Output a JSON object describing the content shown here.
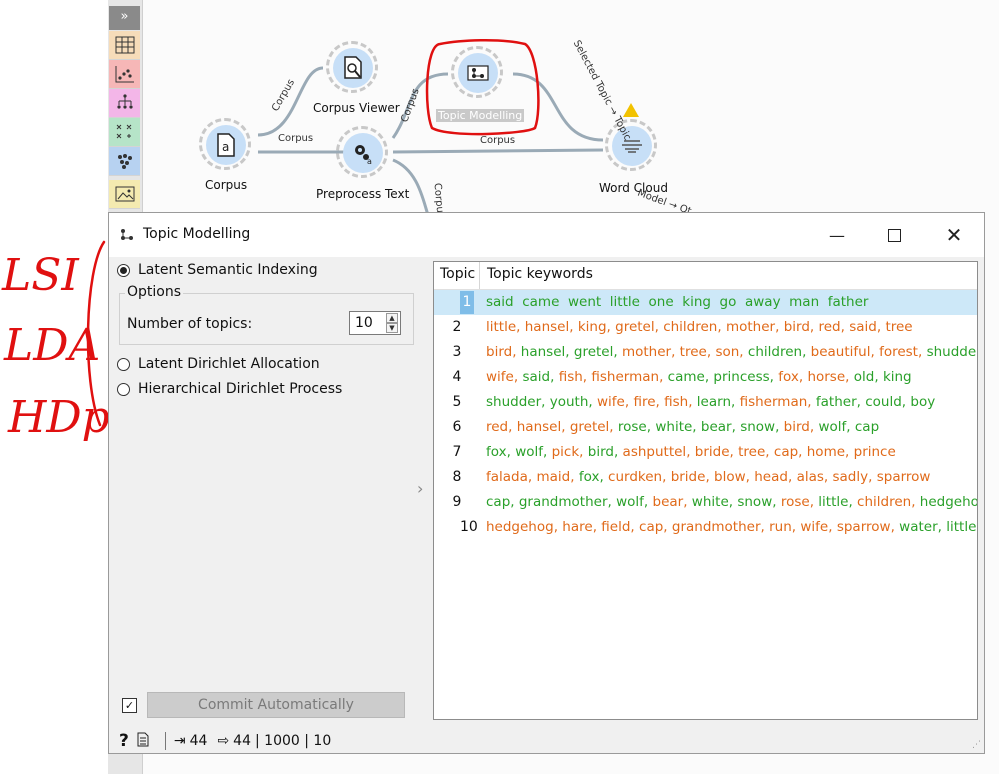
{
  "canvas": {
    "nodes": [
      {
        "label": "Corpus Viewer",
        "icon": "corpus-viewer-icon"
      },
      {
        "label": "Topic Modelling",
        "icon": "topic-modelling-icon"
      },
      {
        "label": "Corpus",
        "icon": "corpus-icon"
      },
      {
        "label": "Preprocess Text",
        "icon": "preprocess-text-icon"
      },
      {
        "label": "Word Cloud",
        "icon": "word-cloud-icon"
      }
    ],
    "links": [
      {
        "label": "Corpus"
      },
      {
        "label": "Corpus"
      },
      {
        "label": "Corpus"
      },
      {
        "label": "Corpus"
      },
      {
        "label": "Selected Topic → Topic"
      },
      {
        "label": "Corpus"
      },
      {
        "label": "Model → Ot"
      }
    ],
    "toolbox": {
      "collapse_label": "»"
    }
  },
  "annotations": {
    "left_labels": [
      "LSI",
      "LDA",
      "HDp"
    ]
  },
  "dialog": {
    "title": "Topic Modelling",
    "title_icon": "topic-modelling-icon",
    "methods": [
      {
        "label": "Latent Semantic Indexing",
        "selected": true
      },
      {
        "label": "Latent Dirichlet Allocation",
        "selected": false
      },
      {
        "label": "Hierarchical Dirichlet Process",
        "selected": false
      }
    ],
    "options_legend": "Options",
    "num_topics_label": "Number of topics:",
    "num_topics_value": "10",
    "table": {
      "headers": [
        "Topic",
        "Topic keywords"
      ],
      "rows": [
        {
          "topic": "1",
          "keywords": [
            "said",
            "came",
            "went",
            "little",
            "one",
            "king",
            "go",
            "away",
            "man",
            "father"
          ],
          "colors": [
            "#2aa02a",
            "#2aa02a",
            "#2aa02a",
            "#2aa02a",
            "#2aa02a",
            "#2aa02a",
            "#2aa02a",
            "#2aa02a",
            "#2aa02a",
            "#2aa02a"
          ],
          "sep": "  "
        },
        {
          "topic": "2",
          "keywords": [
            "little",
            "hansel",
            "king",
            "gretel",
            "children",
            "mother",
            "bird",
            "red",
            "said",
            "tree"
          ],
          "colors": [
            "#e06a1a",
            "#e06a1a",
            "#e06a1a",
            "#e06a1a",
            "#e06a1a",
            "#e06a1a",
            "#e06a1a",
            "#e06a1a",
            "#e06a1a",
            "#e06a1a"
          ],
          "sep": ", "
        },
        {
          "topic": "3",
          "keywords": [
            "bird",
            "hansel",
            "gretel",
            "mother",
            "tree",
            "son",
            "children",
            "beautiful",
            "forest",
            "shudder"
          ],
          "colors": [
            "#e06a1a",
            "#2aa02a",
            "#2aa02a",
            "#e06a1a",
            "#e06a1a",
            "#e06a1a",
            "#2aa02a",
            "#e06a1a",
            "#e06a1a",
            "#2aa02a"
          ],
          "sep": ", "
        },
        {
          "topic": "4",
          "keywords": [
            "wife",
            "said",
            "fish",
            "fisherman",
            "came",
            "princess",
            "fox",
            "horse",
            "old",
            "king"
          ],
          "colors": [
            "#e06a1a",
            "#2aa02a",
            "#e06a1a",
            "#e06a1a",
            "#2aa02a",
            "#2aa02a",
            "#e06a1a",
            "#e06a1a",
            "#2aa02a",
            "#2aa02a"
          ],
          "sep": ", "
        },
        {
          "topic": "5",
          "keywords": [
            "shudder",
            "youth",
            "wife",
            "fire",
            "fish",
            "learn",
            "fisherman",
            "father",
            "could",
            "boy"
          ],
          "colors": [
            "#2aa02a",
            "#2aa02a",
            "#e06a1a",
            "#e06a1a",
            "#e06a1a",
            "#2aa02a",
            "#e06a1a",
            "#2aa02a",
            "#2aa02a",
            "#2aa02a"
          ],
          "sep": ", "
        },
        {
          "topic": "6",
          "keywords": [
            "red",
            "hansel",
            "gretel",
            "rose",
            "white",
            "bear",
            "snow",
            "bird",
            "wolf",
            "cap"
          ],
          "colors": [
            "#e06a1a",
            "#e06a1a",
            "#e06a1a",
            "#2aa02a",
            "#2aa02a",
            "#2aa02a",
            "#2aa02a",
            "#e06a1a",
            "#2aa02a",
            "#2aa02a"
          ],
          "sep": ", "
        },
        {
          "topic": "7",
          "keywords": [
            "fox",
            "wolf",
            "pick",
            "bird",
            "ashputtel",
            "bride",
            "tree",
            "cap",
            "home",
            "prince"
          ],
          "colors": [
            "#2aa02a",
            "#2aa02a",
            "#e06a1a",
            "#2aa02a",
            "#e06a1a",
            "#e06a1a",
            "#e06a1a",
            "#e06a1a",
            "#e06a1a",
            "#e06a1a"
          ],
          "sep": ", "
        },
        {
          "topic": "8",
          "keywords": [
            "falada",
            "maid",
            "fox",
            "curdken",
            "bride",
            "blow",
            "head",
            "alas",
            "sadly",
            "sparrow"
          ],
          "colors": [
            "#e06a1a",
            "#e06a1a",
            "#2aa02a",
            "#e06a1a",
            "#e06a1a",
            "#e06a1a",
            "#e06a1a",
            "#e06a1a",
            "#e06a1a",
            "#e06a1a"
          ],
          "sep": ", "
        },
        {
          "topic": "9",
          "keywords": [
            "cap",
            "grandmother",
            "wolf",
            "bear",
            "white",
            "snow",
            "rose",
            "little",
            "children",
            "hedgehog"
          ],
          "colors": [
            "#2aa02a",
            "#2aa02a",
            "#2aa02a",
            "#e06a1a",
            "#2aa02a",
            "#2aa02a",
            "#e06a1a",
            "#2aa02a",
            "#e06a1a",
            "#2aa02a"
          ],
          "sep": ", "
        },
        {
          "topic": "10",
          "keywords": [
            "hedgehog",
            "hare",
            "field",
            "cap",
            "grandmother",
            "run",
            "wife",
            "sparrow",
            "water",
            "little"
          ],
          "colors": [
            "#e06a1a",
            "#e06a1a",
            "#e06a1a",
            "#e06a1a",
            "#e06a1a",
            "#e06a1a",
            "#e06a1a",
            "#e06a1a",
            "#2aa02a",
            "#2aa02a"
          ],
          "sep": ", "
        }
      ]
    },
    "commit_checked": true,
    "commit_label": "Commit Automatically",
    "status": {
      "input_count": "44",
      "output_count": "44",
      "extra": "| 1000 | 10"
    }
  },
  "colors": {
    "positive": "#2aa02a",
    "negative": "#e06a1a",
    "selection": "#cde8f8",
    "annotation": "#e01010"
  }
}
